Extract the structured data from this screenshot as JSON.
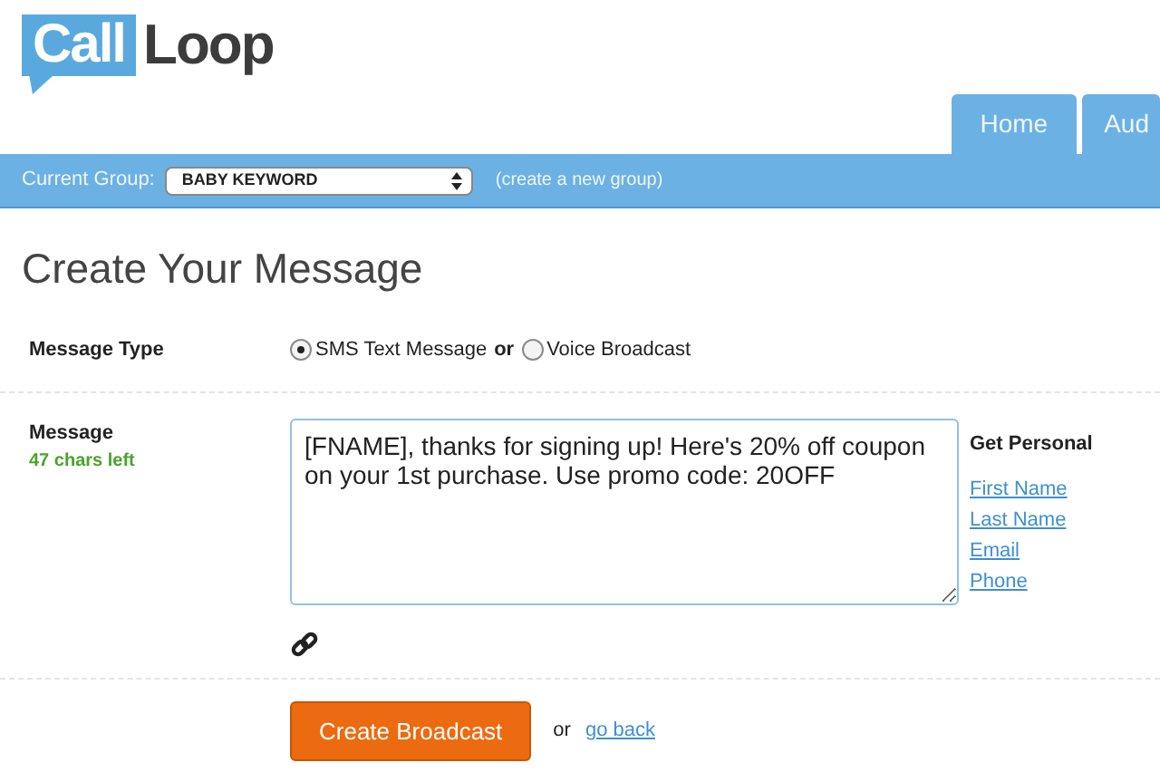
{
  "logo": {
    "word_1": "Call",
    "word_2": "Loop"
  },
  "tabs": [
    {
      "label": "Home"
    },
    {
      "label": "Aud"
    }
  ],
  "group_bar": {
    "label": "Current Group:",
    "value": "BABY KEYWORD",
    "link": "(create a new group)"
  },
  "heading": "Create Your Message",
  "message_type": {
    "label": "Message Type",
    "separator": "or",
    "options": [
      {
        "label": "SMS Text Message",
        "selected": true
      },
      {
        "label": "Voice Broadcast",
        "selected": false
      }
    ]
  },
  "message": {
    "label": "Message",
    "counter": "47 chars left",
    "value": "[FNAME], thanks for signing up! Here's 20% off coupon on your 1st purchase. Use promo code: 20OFF",
    "personal": {
      "title": "Get Personal",
      "links": [
        "First Name",
        "Last Name",
        "Email",
        "Phone"
      ]
    }
  },
  "actions": {
    "button": "Create Broadcast",
    "separator": "or",
    "link": "go back"
  }
}
